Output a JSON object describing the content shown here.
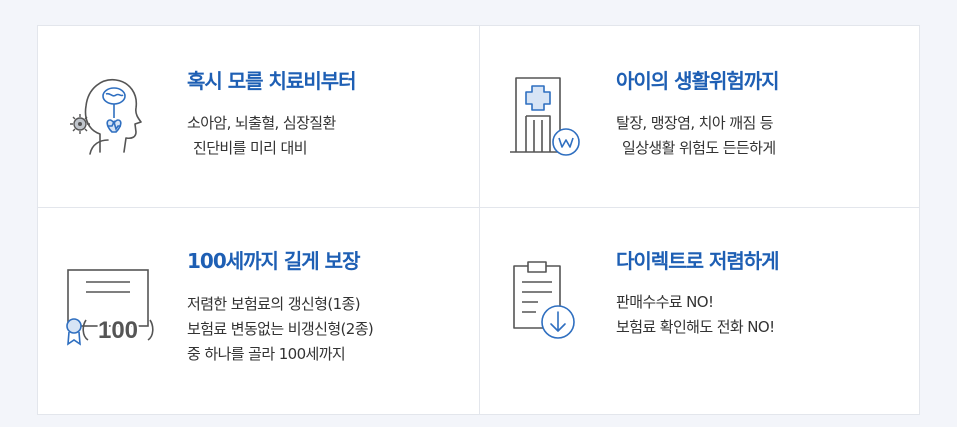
{
  "features": [
    {
      "title": "혹시 모를 치료비부터",
      "icon": "brain-heart-icon",
      "lines": [
        "소아암, 뇌출혈, 심장질환",
        "진단비를 미리 대비"
      ]
    },
    {
      "title": "아이의 생활위험까지",
      "icon": "hospital-building-icon",
      "lines": [
        "탈장, 맹장염, 치아 깨짐 등",
        "일상생활 위험도 든든하게"
      ]
    },
    {
      "title": "100세까지 길게 보장",
      "icon": "certificate-100-icon",
      "badge": "100",
      "lines": [
        "저렴한 보험료의 갱신형(1종)",
        "보험료 변동없는 비갱신형(2종)",
        "중 하나를 골라 100세까지"
      ]
    },
    {
      "title": "다이렉트로 저렴하게",
      "icon": "clipboard-download-icon",
      "lines": [
        "판매수수료 NO!",
        "보험료 확인해도 전화 NO!"
      ]
    }
  ],
  "colors": {
    "accent": "#1e5fb4",
    "icon_line": "#555555",
    "icon_blue": "#2f6fc0",
    "background": "#f3f5fa"
  }
}
